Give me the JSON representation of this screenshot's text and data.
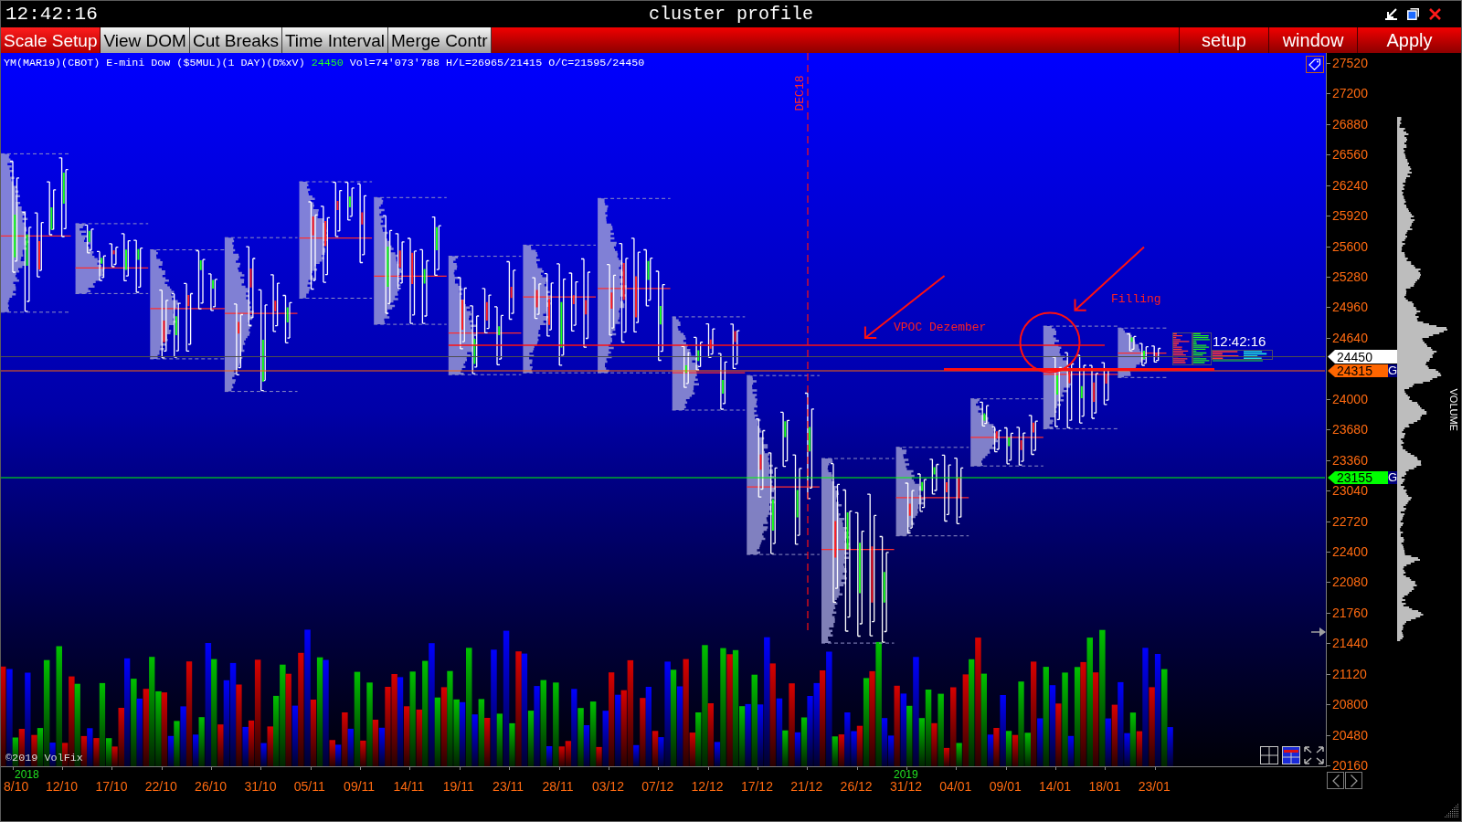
{
  "window": {
    "clock": "12:42:16",
    "title": "cluster profile"
  },
  "toolbar": {
    "tabs": [
      {
        "label": "Scale Setup",
        "selected": true
      },
      {
        "label": "View DOM",
        "selected": false
      },
      {
        "label": "Cut Breaks",
        "selected": false
      },
      {
        "label": "Time Interval",
        "selected": false
      },
      {
        "label": "Merge Contr",
        "selected": false
      }
    ],
    "actions": [
      "setup",
      "window",
      "Apply"
    ]
  },
  "chart": {
    "header": {
      "instrument": "YM(MAR19)(CBOT) E-mini Dow ($5MUL)(1 DAY)(D%xV)",
      "last": "24450",
      "stats": "Vol=74'073'788 H/L=26965/21415 O/C=21595/24450"
    },
    "session_marker": "DEC18",
    "annotations": [
      "VPOC Dezember",
      "Filling"
    ],
    "live_time": "12:42:16",
    "copyright": "©2019 VolFix",
    "price_tags": [
      {
        "kind": "last",
        "value": "24450",
        "color": "#ffffff"
      },
      {
        "kind": "alert",
        "value": "24315",
        "color": "#ff6600",
        "badge": "G"
      },
      {
        "kind": "alert",
        "value": "23155",
        "color": "#00ff00",
        "badge": "G"
      }
    ],
    "price_axis": [
      "27520",
      "27200",
      "26880",
      "26560",
      "26240",
      "25920",
      "25600",
      "25280",
      "24960",
      "24640",
      "24000",
      "23680",
      "23360",
      "23040",
      "22720",
      "22400",
      "22080",
      "21760",
      "21440",
      "21120",
      "20800",
      "20480",
      "20160"
    ],
    "years": [
      "2018",
      "2019"
    ],
    "dates": [
      "8/10",
      "12/10",
      "17/10",
      "22/10",
      "26/10",
      "31/10",
      "05/11",
      "09/11",
      "14/11",
      "19/11",
      "23/11",
      "28/11",
      "03/12",
      "07/12",
      "12/12",
      "17/12",
      "21/12",
      "26/12",
      "31/12",
      "04/01",
      "09/01",
      "14/01",
      "18/01",
      "23/01"
    ]
  },
  "volume_profile": {
    "label": "VOLUME"
  }
}
